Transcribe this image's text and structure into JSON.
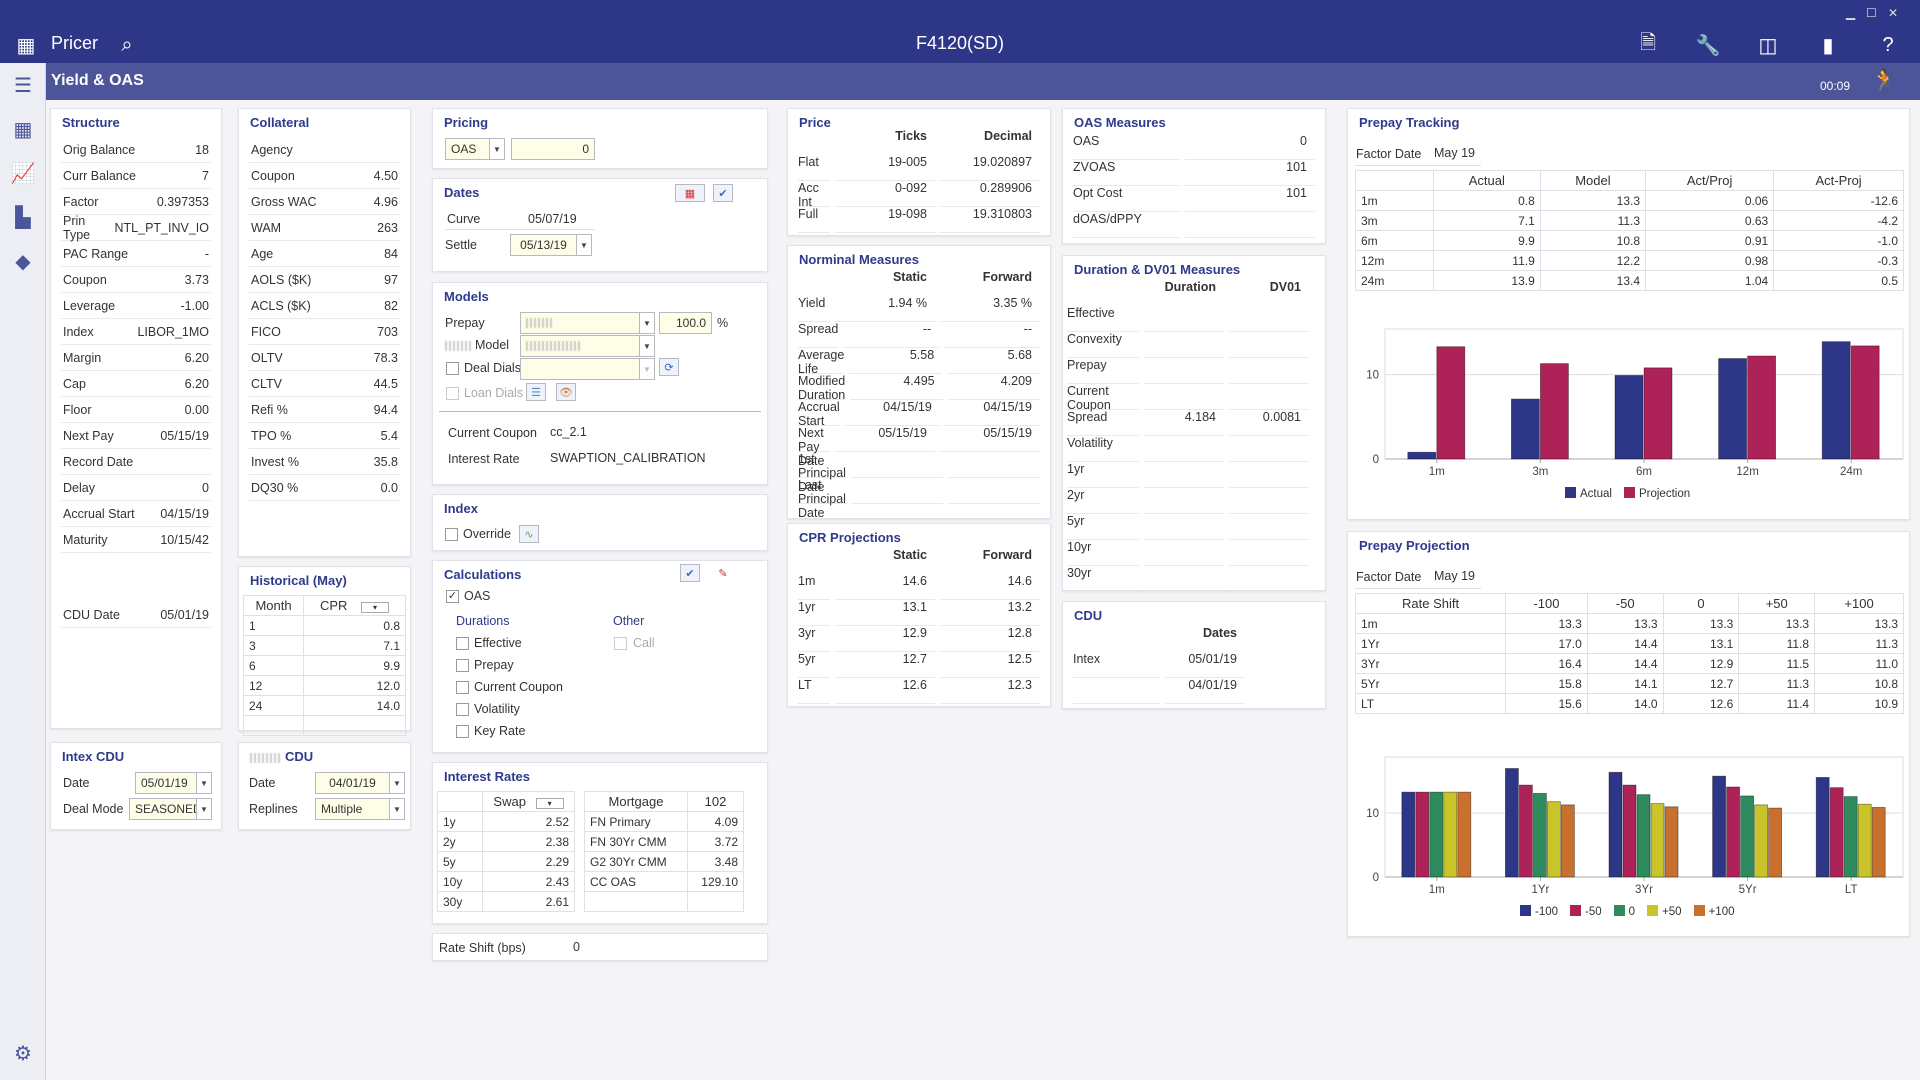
{
  "app": {
    "name": "Pricer",
    "document": "F4120(SD)",
    "page_title": "Yield & OAS",
    "timer": "00:09",
    "colors": {
      "header": "#2e3787",
      "subheader": "#4c5599",
      "panel_title": "#2e3a8c"
    }
  },
  "structure": {
    "title": "Structure",
    "rows": [
      {
        "label": "Orig Balance",
        "value": "18"
      },
      {
        "label": "Curr Balance",
        "value": "7"
      },
      {
        "label": "Factor",
        "value": "0.397353"
      },
      {
        "label": "Prin Type",
        "value": "NTL_PT_INV_IO"
      },
      {
        "label": "PAC Range",
        "value": "-"
      },
      {
        "label": "Coupon",
        "value": "3.73"
      },
      {
        "label": "Leverage",
        "value": "-1.00"
      },
      {
        "label": "Index",
        "value": "LIBOR_1MO"
      },
      {
        "label": "Margin",
        "value": "6.20"
      },
      {
        "label": "Cap",
        "value": "6.20"
      },
      {
        "label": "Floor",
        "value": "0.00"
      },
      {
        "label": "Next Pay",
        "value": "05/15/19"
      },
      {
        "label": "Record Date",
        "value": ""
      },
      {
        "label": "Delay",
        "value": "0"
      },
      {
        "label": "Accrual Start",
        "value": "04/15/19"
      },
      {
        "label": "Maturity",
        "value": "10/15/42"
      }
    ],
    "cdu_date": {
      "label": "CDU Date",
      "value": "05/01/19"
    }
  },
  "collateral": {
    "title": "Collateral",
    "rows": [
      {
        "label": "Agency",
        "value": ""
      },
      {
        "label": "Coupon",
        "value": "4.50"
      },
      {
        "label": "Gross WAC",
        "value": "4.96"
      },
      {
        "label": "WAM",
        "value": "263"
      },
      {
        "label": "Age",
        "value": "84"
      },
      {
        "label": "AOLS ($K)",
        "value": "97"
      },
      {
        "label": "ACLS ($K)",
        "value": "82"
      },
      {
        "label": "FICO",
        "value": "703"
      },
      {
        "label": "OLTV",
        "value": "78.3"
      },
      {
        "label": "CLTV",
        "value": "44.5"
      },
      {
        "label": "Refi %",
        "value": "94.4"
      },
      {
        "label": "TPO %",
        "value": "5.4"
      },
      {
        "label": "Invest %",
        "value": "35.8"
      },
      {
        "label": "DQ30 %",
        "value": "0.0"
      }
    ]
  },
  "historical": {
    "title": "Historical (May)",
    "columns": [
      "Month",
      "CPR"
    ],
    "rows": [
      [
        "1",
        "0.8"
      ],
      [
        "3",
        "7.1"
      ],
      [
        "6",
        "9.9"
      ],
      [
        "12",
        "12.0"
      ],
      [
        "24",
        "14.0"
      ]
    ]
  },
  "intex_cdu": {
    "title": "Intex CDU",
    "date_label": "Date",
    "date": "05/01/19",
    "mode_label": "Deal Mode",
    "mode": "SEASONED"
  },
  "other_cdu": {
    "title": "CDU",
    "date_label": "Date",
    "date": "04/01/19",
    "replines_label": "Replines",
    "replines": "Multiple"
  },
  "pricing": {
    "title": "Pricing",
    "type": "OAS",
    "value": "0"
  },
  "dates": {
    "title": "Dates",
    "curve_label": "Curve",
    "curve": "05/07/19",
    "settle_label": "Settle",
    "settle": "05/13/19"
  },
  "models": {
    "title": "Models",
    "prepay_label": "Prepay",
    "prepay_pct": "100.0",
    "pct_sign": "%",
    "model_label": "Model",
    "deal_dials": "Deal Dials",
    "loan_dials": "Loan Dials",
    "current_coupon_label": "Current Coupon",
    "current_coupon": "cc_2.1",
    "interest_rate_label": "Interest Rate",
    "interest_rate": "SWAPTION_CALIBRATION"
  },
  "index": {
    "title": "Index",
    "override": "Override"
  },
  "calculations": {
    "title": "Calculations",
    "oas": "OAS",
    "oas_checked": true,
    "durations_title": "Durations",
    "other_title": "Other",
    "durations": [
      "Effective",
      "Prepay",
      "Current Coupon",
      "Volatility",
      "Key Rate"
    ],
    "other": [
      "Call"
    ]
  },
  "interest_rates": {
    "title": "Interest Rates",
    "swap_header": "Swap",
    "swap": [
      [
        "1y",
        "2.52"
      ],
      [
        "2y",
        "2.38"
      ],
      [
        "5y",
        "2.29"
      ],
      [
        "10y",
        "2.43"
      ],
      [
        "30y",
        "2.61"
      ]
    ],
    "mortgage_header": "Mortgage",
    "mortgage_value_header": "102",
    "mortgage": [
      [
        "FN Primary",
        "4.09"
      ],
      [
        "FN 30Yr CMM",
        "3.72"
      ],
      [
        "G2 30Yr CMM",
        "3.48"
      ],
      [
        "CC OAS",
        "129.10"
      ]
    ]
  },
  "rate_shift": {
    "label": "Rate Shift (bps)",
    "value": "0"
  },
  "price": {
    "title": "Price",
    "columns": [
      "Ticks",
      "Decimal"
    ],
    "rows": [
      [
        "Flat",
        "19-005",
        "19.020897"
      ],
      [
        "Acc Int",
        "0-092",
        "0.289906"
      ],
      [
        "Full",
        "19-098",
        "19.310803"
      ]
    ]
  },
  "nominal": {
    "title": "Norminal Measures",
    "columns": [
      "Static",
      "Forward"
    ],
    "rows": [
      [
        "Yield",
        "1.94 %",
        "3.35 %"
      ],
      [
        "Spread",
        "--",
        "--"
      ],
      [
        "Average Life",
        "5.58",
        "5.68"
      ],
      [
        "Modified Duration",
        "4.495",
        "4.209"
      ],
      [
        "Accrual Start",
        "04/15/19",
        "04/15/19"
      ],
      [
        "Next Pay Date",
        "05/15/19",
        "05/15/19"
      ],
      [
        "1st Principal Date",
        "",
        ""
      ],
      [
        "Last Principal Date",
        "",
        ""
      ]
    ]
  },
  "cpr": {
    "title": "CPR Projections",
    "columns": [
      "Static",
      "Forward"
    ],
    "rows": [
      [
        "1m",
        "14.6",
        "14.6"
      ],
      [
        "1yr",
        "13.1",
        "13.2"
      ],
      [
        "3yr",
        "12.9",
        "12.8"
      ],
      [
        "5yr",
        "12.7",
        "12.5"
      ],
      [
        "LT",
        "12.6",
        "12.3"
      ]
    ]
  },
  "oas_measures": {
    "title": "OAS Measures",
    "rows": [
      [
        "OAS",
        "0"
      ],
      [
        "ZVOAS",
        "101"
      ],
      [
        "Opt Cost",
        "101"
      ],
      [
        "dOAS/dPPY",
        ""
      ]
    ]
  },
  "duration": {
    "title": "Duration & DV01 Measures",
    "columns": [
      "Duration",
      "DV01"
    ],
    "rows": [
      [
        "Effective",
        "",
        ""
      ],
      [
        "Convexity",
        "",
        ""
      ],
      [
        "Prepay",
        "",
        ""
      ],
      [
        "Current Coupon",
        "",
        ""
      ],
      [
        "Spread",
        "4.184",
        "0.0081"
      ],
      [
        "Volatility",
        "",
        ""
      ],
      [
        "1yr",
        "",
        ""
      ],
      [
        "2yr",
        "",
        ""
      ],
      [
        "5yr",
        "",
        ""
      ],
      [
        "10yr",
        "",
        ""
      ],
      [
        "30yr",
        "",
        ""
      ]
    ]
  },
  "cdu": {
    "title": "CDU",
    "columns": [
      "Dates"
    ],
    "rows": [
      [
        "Intex",
        "05/01/19"
      ],
      [
        "",
        "04/01/19"
      ]
    ]
  },
  "prepay_tracking": {
    "title": "Prepay Tracking",
    "factor_label": "Factor Date",
    "factor": "May 19",
    "columns": [
      "",
      "Actual",
      "Model",
      "Act/Proj",
      "Act-Proj"
    ],
    "rows": [
      [
        "1m",
        "0.8",
        "13.3",
        "0.06",
        "-12.6"
      ],
      [
        "3m",
        "7.1",
        "11.3",
        "0.63",
        "-4.2"
      ],
      [
        "6m",
        "9.9",
        "10.8",
        "0.91",
        "-1.0"
      ],
      [
        "12m",
        "11.9",
        "12.2",
        "0.98",
        "-0.3"
      ],
      [
        "24m",
        "13.9",
        "13.4",
        "1.04",
        "0.5"
      ]
    ]
  },
  "prepay_projection": {
    "title": "Prepay Projection",
    "factor_label": "Factor Date",
    "factor": "May 19",
    "columns": [
      "Rate Shift",
      "-100",
      "-50",
      "0",
      "+50",
      "+100"
    ],
    "rows": [
      [
        "1m",
        "13.3",
        "13.3",
        "13.3",
        "13.3",
        "13.3"
      ],
      [
        "1Yr",
        "17.0",
        "14.4",
        "13.1",
        "11.8",
        "11.3"
      ],
      [
        "3Yr",
        "16.4",
        "14.4",
        "12.9",
        "11.5",
        "11.0"
      ],
      [
        "5Yr",
        "15.8",
        "14.1",
        "12.7",
        "11.3",
        "10.8"
      ],
      [
        "LT",
        "15.6",
        "14.0",
        "12.6",
        "11.4",
        "10.9"
      ]
    ]
  },
  "chart_data": [
    {
      "type": "bar",
      "categories": [
        "1m",
        "3m",
        "6m",
        "12m",
        "24m"
      ],
      "ylim": [
        0,
        15.4
      ],
      "yticks": [
        0,
        10
      ],
      "grid": true,
      "legend": "bottom",
      "series": [
        {
          "name": "Actual",
          "color": "#2e3787",
          "values": [
            0.8,
            7.1,
            9.9,
            11.9,
            13.9
          ]
        },
        {
          "name": "Projection",
          "color": "#ad2358",
          "values": [
            13.3,
            11.3,
            10.8,
            12.2,
            13.4
          ]
        }
      ]
    },
    {
      "type": "bar",
      "categories": [
        "1m",
        "1Yr",
        "3Yr",
        "5Yr",
        "LT"
      ],
      "ylim": [
        0,
        18.8
      ],
      "yticks": [
        0,
        10
      ],
      "grid": true,
      "legend": "bottom",
      "series": [
        {
          "name": "-100",
          "color": "#2e3787",
          "values": [
            13.3,
            17.0,
            16.4,
            15.8,
            15.6
          ]
        },
        {
          "name": "-50",
          "color": "#ad2358",
          "values": [
            13.3,
            14.4,
            14.4,
            14.1,
            14.0
          ]
        },
        {
          "name": "0",
          "color": "#2e8b5e",
          "values": [
            13.3,
            13.1,
            12.9,
            12.7,
            12.6
          ]
        },
        {
          "name": "+50",
          "color": "#c8c42a",
          "values": [
            13.3,
            11.8,
            11.5,
            11.3,
            11.4
          ]
        },
        {
          "name": "+100",
          "color": "#c8702e",
          "values": [
            13.3,
            11.3,
            11.0,
            10.8,
            10.9
          ]
        }
      ]
    }
  ]
}
